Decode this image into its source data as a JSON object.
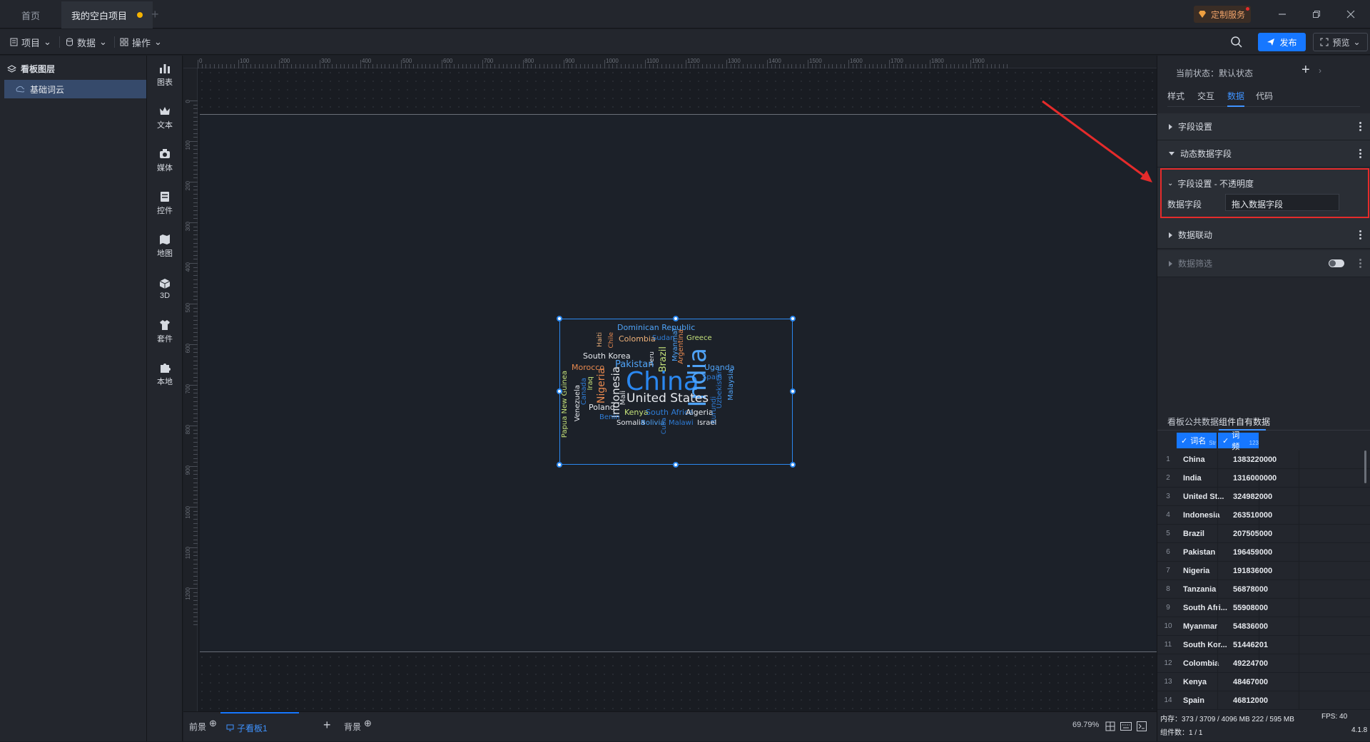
{
  "tabs": [
    {
      "label": "首页"
    },
    {
      "label": "我的空白项目"
    }
  ],
  "window": {
    "custom_service": "定制服务"
  },
  "toolbar": {
    "menus": [
      "项目",
      "数据",
      "操作"
    ],
    "publish": "发布",
    "preview": "预览"
  },
  "layers": {
    "header": "看板图层",
    "items": [
      {
        "label": "基础词云"
      }
    ]
  },
  "components": [
    "图表",
    "文本",
    "媒体",
    "控件",
    "地图",
    "3D",
    "套件",
    "本地"
  ],
  "ruler": {
    "top": [
      "0",
      "100",
      "200",
      "300",
      "400",
      "500",
      "600",
      "700",
      "800",
      "900",
      "1000",
      "1100",
      "1200",
      "1300",
      "1400",
      "1500",
      "1600",
      "1700",
      "1800",
      "1900"
    ],
    "left": [
      "0",
      "100",
      "200",
      "300",
      "400",
      "500",
      "600",
      "700",
      "800",
      "900",
      "1000",
      "1100",
      "1200"
    ]
  },
  "wordcloud": {
    "words": [
      {
        "text": "Dominican Republic",
        "color": "#4fa3f7",
        "size": 11
      },
      {
        "text": "Colombia",
        "color": "#f0b27a",
        "size": 11
      },
      {
        "text": "Sudan",
        "color": "#2e7cd6",
        "size": 10
      },
      {
        "text": "Greece",
        "color": "#c5e27a",
        "size": 10
      },
      {
        "text": "Haiti",
        "color": "#f0b27a",
        "size": 9
      },
      {
        "text": "Chile",
        "color": "#e8894f",
        "size": 9
      },
      {
        "text": "Peru",
        "color": "#e6e9ee",
        "size": 9
      },
      {
        "text": "Brazil",
        "color": "#c5e27a",
        "size": 13
      },
      {
        "text": "Myanmar",
        "color": "#4fa3f7",
        "size": 10
      },
      {
        "text": "Argentina",
        "color": "#e8894f",
        "size": 10
      },
      {
        "text": "South Korea",
        "color": "#e6e9ee",
        "size": 11
      },
      {
        "text": "Pakistan",
        "color": "#4fa3f7",
        "size": 13
      },
      {
        "text": "Uganda",
        "color": "#4fa3f7",
        "size": 11
      },
      {
        "text": "Morocco",
        "color": "#e8894f",
        "size": 11
      },
      {
        "text": "China",
        "color": "#2b88f0",
        "size": 36
      },
      {
        "text": "India",
        "color": "#4fa3f7",
        "size": 34
      },
      {
        "text": "Spain",
        "color": "#2e7cd6",
        "size": 10
      },
      {
        "text": "Nigeria",
        "color": "#e8894f",
        "size": 14
      },
      {
        "text": "Indonesia",
        "color": "#e6e9ee",
        "size": 15
      },
      {
        "text": "Iraq",
        "color": "#c5e27a",
        "size": 10
      },
      {
        "text": "Canada",
        "color": "#2e7cd6",
        "size": 10
      },
      {
        "text": "Mali",
        "color": "#e6e9ee",
        "size": 10
      },
      {
        "text": "United States",
        "color": "#e6e9ee",
        "size": 17
      },
      {
        "text": "Uzbekistan",
        "color": "#2e7cd6",
        "size": 10
      },
      {
        "text": "Malaysia",
        "color": "#4fa3f7",
        "size": 10
      },
      {
        "text": "Papua New Guinea",
        "color": "#c5e27a",
        "size": 10
      },
      {
        "text": "Venezuela",
        "color": "#e6e9ee",
        "size": 10
      },
      {
        "text": "Poland",
        "color": "#e6e9ee",
        "size": 11
      },
      {
        "text": "Kenya",
        "color": "#c5e27a",
        "size": 11
      },
      {
        "text": "South Africa",
        "color": "#2e7cd6",
        "size": 11
      },
      {
        "text": "Algeria",
        "color": "#e6e9ee",
        "size": 11
      },
      {
        "text": "Burundi",
        "color": "#2e7cd6",
        "size": 10
      },
      {
        "text": "Benin",
        "color": "#2e7cd6",
        "size": 10
      },
      {
        "text": "Somalia",
        "color": "#e6e9ee",
        "size": 10
      },
      {
        "text": "Bolivia",
        "color": "#4fa3f7",
        "size": 10
      },
      {
        "text": "Cuba",
        "color": "#2e7cd6",
        "size": 9
      },
      {
        "text": "Malawi",
        "color": "#2e7cd6",
        "size": 10
      },
      {
        "text": "Israel",
        "color": "#e6e9ee",
        "size": 10
      }
    ]
  },
  "bottom": {
    "foreground": "前景",
    "sub_board": "子看板1",
    "background": "背景",
    "zoom": "69.79%"
  },
  "right": {
    "state": "当前状态：默认状态",
    "tabs": [
      "样式",
      "交互",
      "数据",
      "代码"
    ],
    "active_tab": "数据",
    "sections": {
      "field_settings": "字段设置",
      "dynamic_fields": "动态数据字段",
      "opacity_header": "字段设置 - 不透明度",
      "data_field_label": "数据字段",
      "data_field_value": "拖入数据字段",
      "linkage": "数据联动",
      "filter": "数据筛选"
    },
    "data_tabs": [
      "看板公共数据",
      "组件自有数据"
    ],
    "columns": [
      {
        "name": "词名",
        "type": "Str"
      },
      {
        "name": "词频",
        "type": "123"
      }
    ],
    "rows": [
      {
        "name": "China",
        "value": "1383220000"
      },
      {
        "name": "India",
        "value": "1316000000"
      },
      {
        "name": "United St...",
        "value": "324982000"
      },
      {
        "name": "Indonesia",
        "value": "263510000"
      },
      {
        "name": "Brazil",
        "value": "207505000"
      },
      {
        "name": "Pakistan",
        "value": "196459000"
      },
      {
        "name": "Nigeria",
        "value": "191836000"
      },
      {
        "name": "Tanzania",
        "value": "56878000"
      },
      {
        "name": "South Afri...",
        "value": "55908000"
      },
      {
        "name": "Myanmar",
        "value": "54836000"
      },
      {
        "name": "South Kor...",
        "value": "51446201"
      },
      {
        "name": "Colombia",
        "value": "49224700"
      },
      {
        "name": "Kenya",
        "value": "48467000"
      },
      {
        "name": "Spain",
        "value": "46812000"
      }
    ],
    "memory": "内存：373 / 3709 / 4096 MB  222 / 595 MB",
    "fps": "FPS:  40",
    "count": "组件数：1 / 1",
    "version": "4.1.8"
  }
}
